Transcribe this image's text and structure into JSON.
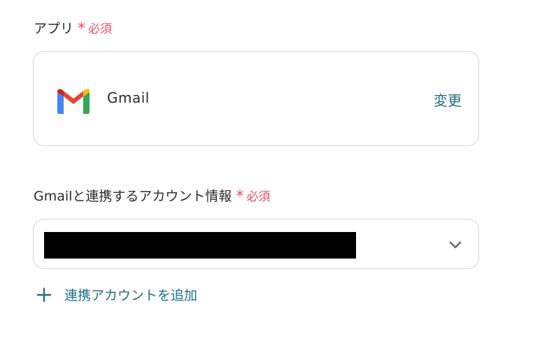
{
  "app_field": {
    "label": "アプリ",
    "required_mark": "*",
    "required_text": "必須",
    "selected_app": {
      "name": "Gmail",
      "icon": "gmail-icon",
      "change_label": "変更"
    }
  },
  "account_field": {
    "label": "Gmailと連携するアカウント情報",
    "required_mark": "*",
    "required_text": "必須",
    "selected_value_icon": "chevron-down-icon",
    "add_account_label": "連携アカウントを追加",
    "add_account_icon": "plus-icon"
  },
  "colors": {
    "required": "#ea4d63",
    "link": "#1f6f82",
    "border": "#d3d5d9",
    "text": "#2b2b2b"
  }
}
